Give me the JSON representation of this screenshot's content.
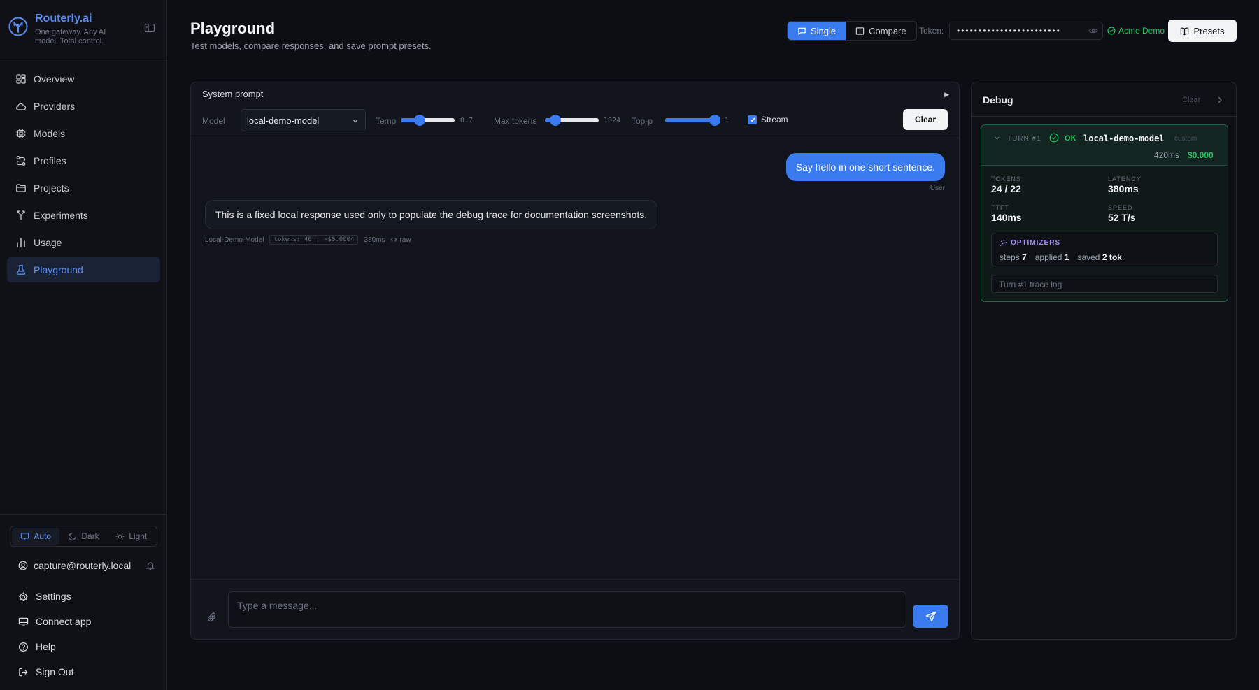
{
  "brand": {
    "name": "Routerly.ai",
    "tagline": "One gateway. Any AI model. Total control.",
    "accent": "#5b8def"
  },
  "sidebar": {
    "items": [
      {
        "label": "Overview",
        "icon": "grid-icon"
      },
      {
        "label": "Providers",
        "icon": "cloud-icon"
      },
      {
        "label": "Models",
        "icon": "cpu-icon"
      },
      {
        "label": "Profiles",
        "icon": "route-icon"
      },
      {
        "label": "Projects",
        "icon": "folder-icon"
      },
      {
        "label": "Experiments",
        "icon": "branch-icon"
      },
      {
        "label": "Usage",
        "icon": "bar-chart-icon"
      },
      {
        "label": "Playground",
        "icon": "flask-icon",
        "active": true
      }
    ],
    "theme": {
      "auto": "Auto",
      "dark": "Dark",
      "light": "Light",
      "selected": "Auto"
    },
    "user_email": "capture@routerly.local",
    "links": [
      {
        "label": "Settings",
        "icon": "gear-icon"
      },
      {
        "label": "Connect app",
        "icon": "monitor-icon"
      },
      {
        "label": "Help",
        "icon": "help-icon"
      },
      {
        "label": "Sign Out",
        "icon": "sign-out-icon"
      }
    ]
  },
  "header": {
    "title": "Playground",
    "subtitle": "Test models, compare responses, and save prompt presets.",
    "modes": {
      "single": "Single",
      "compare": "Compare",
      "selected": "Single"
    },
    "token_label": "Token:",
    "token_value": "••••••••••••••••••••••••",
    "token_status": "Acme Demo",
    "presets_label": "Presets"
  },
  "controls": {
    "system_prompt_label": "System prompt",
    "model_label": "Model",
    "model_value": "local-demo-model",
    "temp_label": "Temp",
    "temp_value": "0.7",
    "temp_fraction": 0.35,
    "max_tokens_label": "Max tokens",
    "max_tokens_value": "1024",
    "max_tokens_fraction": 0.2,
    "top_p_label": "Top-p",
    "top_p_value": "1",
    "top_p_fraction": 0.92,
    "stream_label": "Stream",
    "stream_checked": true,
    "clear_label": "Clear"
  },
  "chat": {
    "user_message": "Say hello in one short sentence.",
    "user_tag": "User",
    "assistant_message": "This is a fixed local response used only to populate the debug trace for documentation screenshots.",
    "assistant_model": "Local-Demo-Model",
    "meta_tokens": "tokens: 46",
    "meta_cost": "~$0.0004",
    "meta_latency": "380ms",
    "meta_raw": "raw",
    "input_placeholder": "Type a message..."
  },
  "debug": {
    "title": "Debug",
    "clear_label": "Clear",
    "turn": {
      "label": "TURN #1",
      "status": "OK",
      "model": "local-demo-model",
      "kind": "custom",
      "latency": "420ms",
      "cost": "$0.000",
      "stats": {
        "tokens_label": "TOKENS",
        "tokens_value": "24 / 22",
        "latency_label": "LATENCY",
        "latency_value": "380ms",
        "ttft_label": "TTFT",
        "ttft_value": "140ms",
        "speed_label": "SPEED",
        "speed_value": "52 T/s"
      },
      "optimizers": {
        "title": "OPTIMIZERS",
        "steps_label": "steps",
        "steps_value": "7",
        "applied_label": "applied",
        "applied_value": "1",
        "saved_label": "saved",
        "saved_value": "2 tok"
      },
      "trace_label": "Turn #1 trace log"
    }
  },
  "colors": {
    "primary": "#3b7bf0",
    "success": "#22c55e",
    "optimizer": "#a78bfa",
    "background": "#0c0e13"
  }
}
